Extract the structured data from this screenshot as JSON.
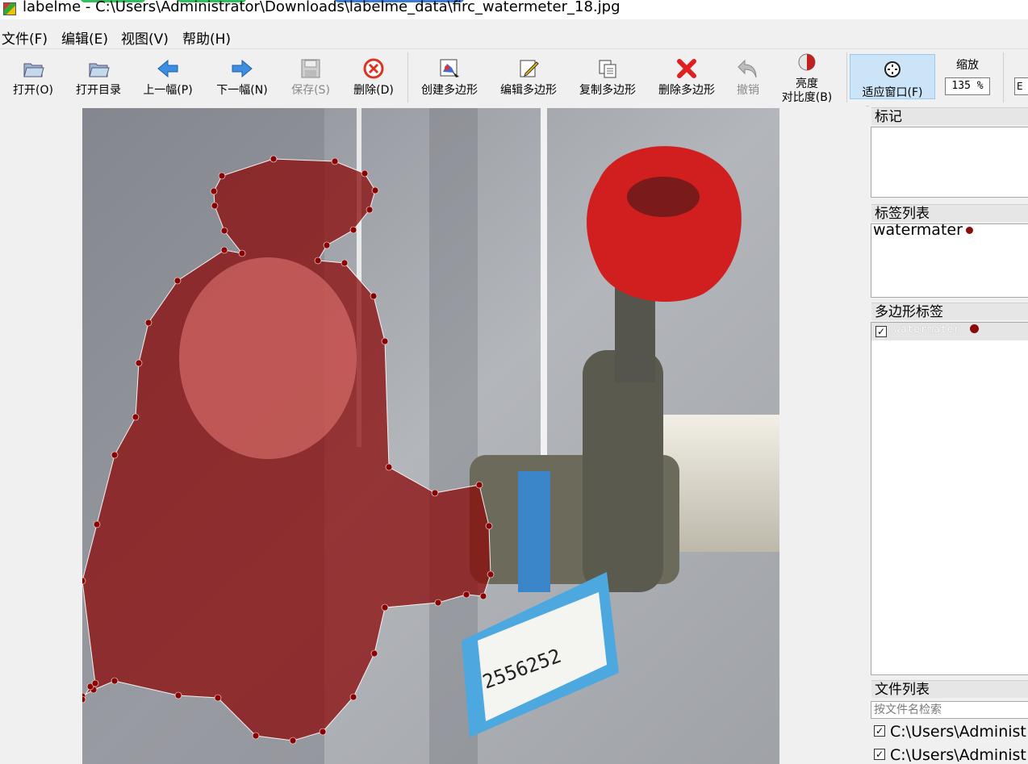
{
  "window": {
    "title": "labelme - C:\\Users\\Administrator\\Downloads\\labelme_data\\firc_watermeter_18.jpg"
  },
  "menu": [
    "文件(F)",
    "编辑(E)",
    "视图(V)",
    "帮助(H)"
  ],
  "toolbar": {
    "open": "打开(O)",
    "open_dir": "打开目录",
    "prev": "上一幅(P)",
    "next": "下一幅(N)",
    "save": "保存(S)",
    "delete": "删除(D)",
    "create_poly": "创建多边形",
    "edit_poly": "编辑多边形",
    "copy_poly": "复制多边形",
    "delete_poly": "删除多边形",
    "undo": "撤销",
    "brightness_line1": "亮度",
    "brightness_line2": "对比度(B)",
    "fit_window": "适应窗口(F)",
    "zoom_label": "缩放",
    "zoom_value": "135 %",
    "edge_text": "E"
  },
  "panels": {
    "flags_title": "标记",
    "label_list_title": "标签列表",
    "label_list_items": [
      "watermater"
    ],
    "polygon_labels_title": "多边形标签",
    "polygon_items": [
      {
        "label": "watermater",
        "checked": true
      }
    ],
    "file_list_title": "文件列表",
    "file_search_placeholder": "按文件名检索",
    "files": [
      "C:\\Users\\Administ",
      "C:\\Users\\Administ"
    ]
  },
  "colors": {
    "polygon_fill": "#8b0a0a",
    "vertex": "#8b0000",
    "accent_active": "#cce4f7"
  }
}
